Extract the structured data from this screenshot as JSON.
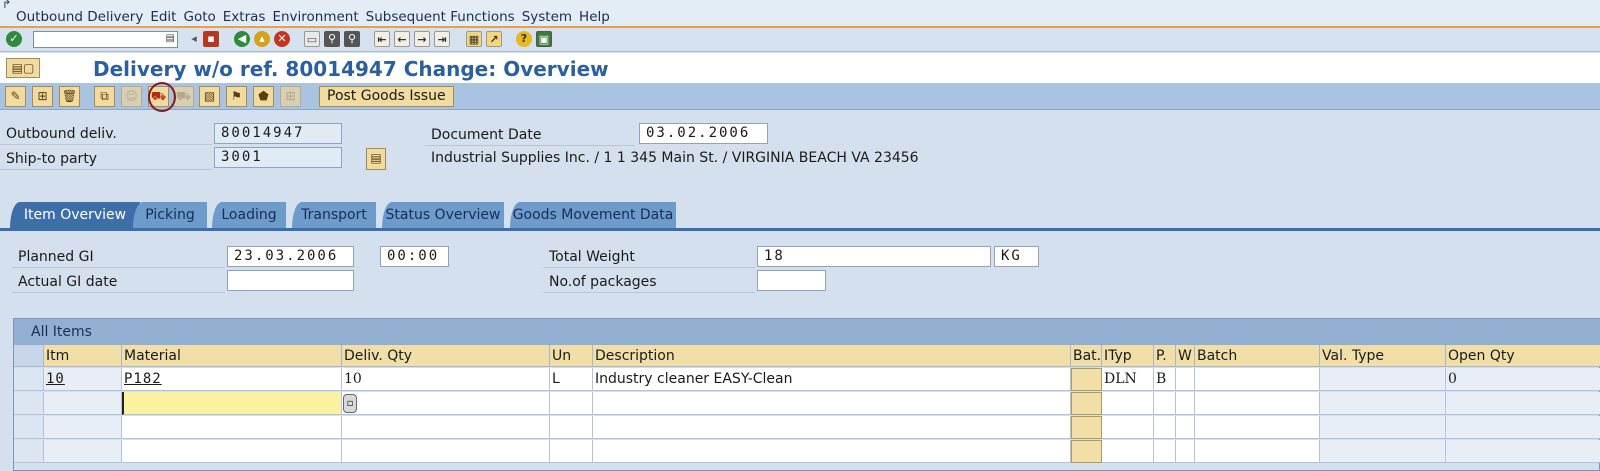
{
  "menu": {
    "corner_glyph": "↱",
    "items": [
      "Outbound Delivery",
      "Edit",
      "Goto",
      "Extras",
      "Environment",
      "Subsequent Functions",
      "System",
      "Help"
    ]
  },
  "system_toolbar": {
    "command_field": "",
    "icons": [
      "enter-icon",
      "back-arrow-icon",
      "save-icon",
      "back-icon",
      "exit-icon",
      "cancel-icon",
      "print-icon",
      "find-icon",
      "find-next-icon",
      "first-page-icon",
      "previous-page-icon",
      "next-page-icon",
      "last-page-icon",
      "create-session-icon",
      "shortcut-icon",
      "help-icon",
      "layout-icon"
    ]
  },
  "title": "Delivery w/o ref. 80014947 Change: Overview",
  "app_toolbar": {
    "post_goods_issue_label": "Post Goods Issue"
  },
  "header": {
    "outbound_delivery_label": "Outbound deliv.",
    "outbound_delivery_value": "80014947",
    "ship_to_label": "Ship-to party",
    "ship_to_value": "3001",
    "ship_to_address": "Industrial Supplies Inc. / 1 1 345 Main St. / VIRGINIA BEACH VA 23456",
    "document_date_label": "Document Date",
    "document_date_value": "03.02.2006"
  },
  "tabs": [
    "Item Overview",
    "Picking",
    "Loading",
    "Transport",
    "Status Overview",
    "Goods Movement Data"
  ],
  "item_overview": {
    "planned_gi_label": "Planned GI",
    "planned_gi_date": "23.03.2006",
    "planned_gi_time": "00:00",
    "actual_gi_label": "Actual GI date",
    "actual_gi_value": "",
    "total_weight_label": "Total Weight",
    "total_weight_value": "18",
    "weight_unit": "KG",
    "packages_label": "No.of packages",
    "packages_value": ""
  },
  "items_table": {
    "title": "All Items",
    "columns": [
      "Itm",
      "Material",
      "Deliv. Qty",
      "Un",
      "Description",
      "Bat.",
      "ITyp",
      "P.",
      "W",
      "Batch",
      "Val. Type",
      "Open Qty"
    ],
    "rows": [
      [
        "10",
        "P182",
        "10",
        "L",
        "Industry cleaner  EASY-Clean",
        "",
        "DLN",
        "B",
        "",
        "",
        "",
        "0"
      ],
      [
        "",
        "",
        "",
        "",
        "",
        "",
        "",
        "",
        "",
        "",
        "",
        ""
      ],
      [
        "",
        "",
        "",
        "",
        "",
        "",
        "",
        "",
        "",
        "",
        "",
        ""
      ],
      [
        "",
        "",
        "",
        "",
        "",
        "",
        "",
        "",
        "",
        "",
        "",
        ""
      ]
    ]
  },
  "colors": {
    "title_blue": "#2b5f9e",
    "button_tan": "#f1dba0",
    "tab_active": "#3d6ea8",
    "highlight_circle": "#8b1a1a",
    "input_focus_yellow": "#fdf1a2"
  }
}
